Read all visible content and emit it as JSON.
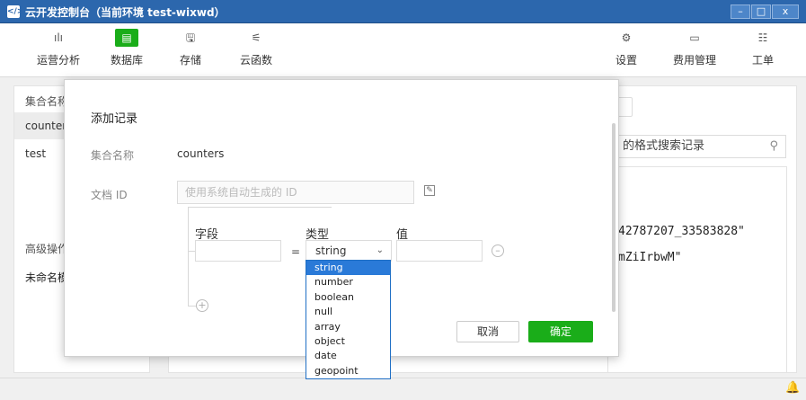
{
  "window": {
    "title": "云开发控制台（当前环境 test-wixwd）",
    "minimize": "–",
    "maximize": "□",
    "close": "x"
  },
  "toolbar": {
    "left": [
      {
        "label": "运营分析",
        "icon": "chart-icon",
        "glyph": "ılı"
      },
      {
        "label": "数据库",
        "icon": "database-icon",
        "glyph": "▤"
      },
      {
        "label": "存储",
        "icon": "storage-icon",
        "glyph": "🖫"
      },
      {
        "label": "云函数",
        "icon": "function-icon",
        "glyph": "⚟"
      }
    ],
    "right": [
      {
        "label": "设置",
        "icon": "gear-icon",
        "glyph": "⚙"
      },
      {
        "label": "费用管理",
        "icon": "billing-icon",
        "glyph": "▭"
      },
      {
        "label": "工单",
        "icon": "ticket-icon",
        "glyph": "☷"
      }
    ],
    "active": "数据库"
  },
  "sidebar": {
    "header": "集合名称",
    "items": [
      "counters",
      "test"
    ],
    "advanced_header": "高级操作",
    "unnamed": "未命名模"
  },
  "main": {
    "search_placeholder": "的格式搜索记录",
    "record_line1": "42787207_33583828\"",
    "record_line2": "mZiIrbwM\""
  },
  "dialog": {
    "title": "添加记录",
    "collection_label": "集合名称",
    "collection_value": "counters",
    "docid_label": "文档 ID",
    "docid_placeholder": "使用系统自动生成的 ID",
    "col_field": "字段",
    "col_type": "类型",
    "col_value": "值",
    "equals": "=",
    "type_selected": "string",
    "remove_glyph": "–",
    "add_glyph": "+",
    "cancel": "取消",
    "confirm": "确定"
  },
  "type_options": [
    "string",
    "number",
    "boolean",
    "null",
    "array",
    "object",
    "date",
    "geopoint"
  ],
  "status": {
    "bell_glyph": "🔔"
  },
  "colors": {
    "accent": "#1aad19",
    "titlebar": "#2c67ad",
    "dropdown_select": "#2a7ad8"
  }
}
